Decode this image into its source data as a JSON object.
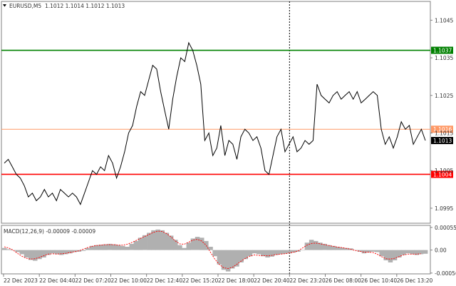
{
  "header": {
    "symbol_label": "EURUSD,M5",
    "ohlc_label": "1.1012 1.1014 1.1012 1.1013"
  },
  "macd_panel": {
    "label": "MACD(12,26,9) -0.00009 -0.00009"
  },
  "colors": {
    "price_line": "#000000",
    "resistance_green": "#008000",
    "support_red": "#ff0000",
    "mid_orange": "#ff9966",
    "histogram": "#b0b0b0",
    "signal": "#ff0000",
    "badge_dark": "#000000",
    "axis": "#808080"
  },
  "icons": {
    "symbol_dropdown": "triangle-down-icon"
  },
  "chart_data": [
    {
      "type": "line",
      "panel": "price",
      "title": "EURUSD,M5",
      "x_labels": [
        "22 Dec 2023",
        "22 Dec 04:40",
        "22 Dec 07:20",
        "22 Dec 10:00",
        "22 Dec 12:40",
        "22 Dec 15:20",
        "22 Dec 18:00",
        "22 Dec 20:40",
        "22 Dec 23:20",
        "26 Dec 08:00",
        "26 Dec 10:40",
        "26 Dec 13:20"
      ],
      "y_ticks": [
        "1.1045",
        "1.1035",
        "1.1025",
        "1.1015",
        "1.1005",
        "1.0995"
      ],
      "y_tick_values": [
        1.1045,
        1.1035,
        1.1025,
        1.1015,
        1.1005,
        1.0995
      ],
      "ylim": [
        1.0991,
        1.105
      ],
      "grid": false,
      "series": [
        {
          "values": [
            1.1007,
            1.1008,
            1.1006,
            1.1004,
            1.1003,
            1.1001,
            1.0998,
            1.0999,
            1.0997,
            1.0998,
            1.1,
            1.0998,
            1.0999,
            1.0997,
            1.1,
            1.0999,
            1.0998,
            1.0999,
            1.0998,
            1.0996,
            1.0999,
            1.1002,
            1.1005,
            1.1004,
            1.1006,
            1.1005,
            1.1009,
            1.1007,
            1.1003,
            1.1006,
            1.101,
            1.1015,
            1.1017,
            1.1022,
            1.1026,
            1.1025,
            1.1029,
            1.1033,
            1.1032,
            1.1026,
            1.1021,
            1.1016,
            1.1024,
            1.103,
            1.1035,
            1.1034,
            1.1039,
            1.1037,
            1.1033,
            1.1028,
            1.1013,
            1.1015,
            1.1009,
            1.1011,
            1.1017,
            1.1009,
            1.1013,
            1.1012,
            1.1008,
            1.1014,
            1.1016,
            1.1015,
            1.1013,
            1.1014,
            1.1011,
            1.1005,
            1.1004,
            1.1009,
            1.1014,
            1.1016,
            1.101,
            1.1012,
            1.1014,
            1.101,
            1.1011,
            1.1013,
            1.1012,
            1.1013,
            1.1028,
            1.1025,
            1.1024,
            1.1023,
            1.1025,
            1.1026,
            1.1024,
            1.1025,
            1.1026,
            1.1024,
            1.1026,
            1.1023,
            1.1024,
            1.1025,
            1.1026,
            1.1025,
            1.1016,
            1.1012,
            1.1014,
            1.1011,
            1.1014,
            1.1018,
            1.1016,
            1.1017,
            1.1012,
            1.1014,
            1.1016,
            1.1013
          ]
        }
      ],
      "levels": [
        {
          "value": 1.1037,
          "label": "1.1037",
          "color": "green"
        },
        {
          "value": 1.1016,
          "label": "1.1016",
          "color": "orange"
        },
        {
          "value": 1.1004,
          "label": "1.1004",
          "color": "red"
        }
      ],
      "current_price": {
        "value": 1.1013,
        "label": "1.1013"
      },
      "session_separator_at": "22 Dec 23:20"
    },
    {
      "type": "bar",
      "panel": "macd",
      "title": "MACD(12,26,9) -0.00009 -0.00009",
      "y_ticks": [
        "0.00055",
        "0.00",
        "-0.00056"
      ],
      "y_tick_values": [
        0.00055,
        0.0,
        -0.00056
      ],
      "ylim": [
        -0.00058,
        0.0006
      ],
      "series": [
        {
          "kind": "histogram",
          "values": [
            5e-05,
            2e-05,
            0.0,
            -5e-05,
            -0.0001,
            -0.00018,
            -0.00024,
            -0.00026,
            -0.00022,
            -0.00018,
            -0.00012,
            -8e-05,
            -0.0001,
            -0.00012,
            -0.0001,
            -8e-05,
            -5e-05,
            -4e-05,
            -2e-05,
            5e-05,
            0.0001,
            0.00012,
            0.00013,
            0.00014,
            0.00015,
            0.00014,
            0.00012,
            0.0001,
            8e-05,
            0.00015,
            0.00022,
            0.0003,
            0.00036,
            0.00042,
            0.00048,
            0.0005,
            0.00048,
            0.00042,
            0.00035,
            0.00025,
            0.00012,
            5e-05,
            0.00018,
            0.00028,
            0.00032,
            0.0003,
            0.00022,
            8e-05,
            -0.00015,
            -0.00035,
            -0.00048,
            -0.00052,
            -0.00045,
            -0.0004,
            -0.0003,
            -0.00022,
            -0.00015,
            -8e-05,
            -0.0001,
            -0.00015,
            -0.00018,
            -0.00016,
            -0.00012,
            -0.0001,
            -9e-05,
            -8e-05,
            -6e-05,
            -4e-05,
            0.0,
            0.00018,
            0.00025,
            0.00022,
            0.00018,
            0.00015,
            0.00012,
            0.0001,
            8e-05,
            6e-05,
            5e-05,
            4e-05,
            0.0,
            -4e-05,
            -8e-05,
            -6e-05,
            -4e-05,
            -5e-05,
            -0.00015,
            -0.00025,
            -0.0003,
            -0.00025,
            -0.00018,
            -0.00012,
            -8e-05,
            -0.0001,
            -0.00012,
            -0.0001,
            -9e-05
          ]
        },
        {
          "kind": "signal",
          "values": [
            8e-05,
            5e-05,
            0.0,
            -8e-05,
            -0.00015,
            -0.0002,
            -0.00022,
            -0.00021,
            -0.00018,
            -0.00014,
            -0.0001,
            -9e-05,
            -0.0001,
            -9e-05,
            -8e-05,
            -6e-05,
            -4e-05,
            -2e-05,
            2e-05,
            6e-05,
            9e-05,
            0.00011,
            0.00012,
            0.00013,
            0.00013,
            0.00013,
            0.00012,
            0.00012,
            0.00014,
            0.00018,
            0.00023,
            0.00028,
            0.00033,
            0.00038,
            0.00043,
            0.00046,
            0.00045,
            0.0004,
            0.00032,
            0.00022,
            0.00015,
            0.00014,
            0.00019,
            0.00024,
            0.00026,
            0.00022,
            0.00012,
            -5e-05,
            -0.00022,
            -0.00035,
            -0.00043,
            -0.00045,
            -0.00042,
            -0.00035,
            -0.00027,
            -0.0002,
            -0.00015,
            -0.00012,
            -0.00013,
            -0.00014,
            -0.00014,
            -0.00013,
            -0.00011,
            -0.0001,
            -9e-05,
            -7e-05,
            -5e-05,
            -2e-05,
            5e-05,
            0.00012,
            0.00016,
            0.00017,
            0.00015,
            0.00013,
            0.00011,
            9e-05,
            7e-05,
            6e-05,
            4e-05,
            2e-05,
            -1e-05,
            -3e-05,
            -5e-05,
            -5e-05,
            -6e-05,
            -0.0001,
            -0.00016,
            -0.00021,
            -0.00022,
            -0.0002,
            -0.00016,
            -0.00012,
            -0.0001,
            -0.0001,
            -0.0001,
            -9e-05
          ]
        }
      ]
    }
  ]
}
